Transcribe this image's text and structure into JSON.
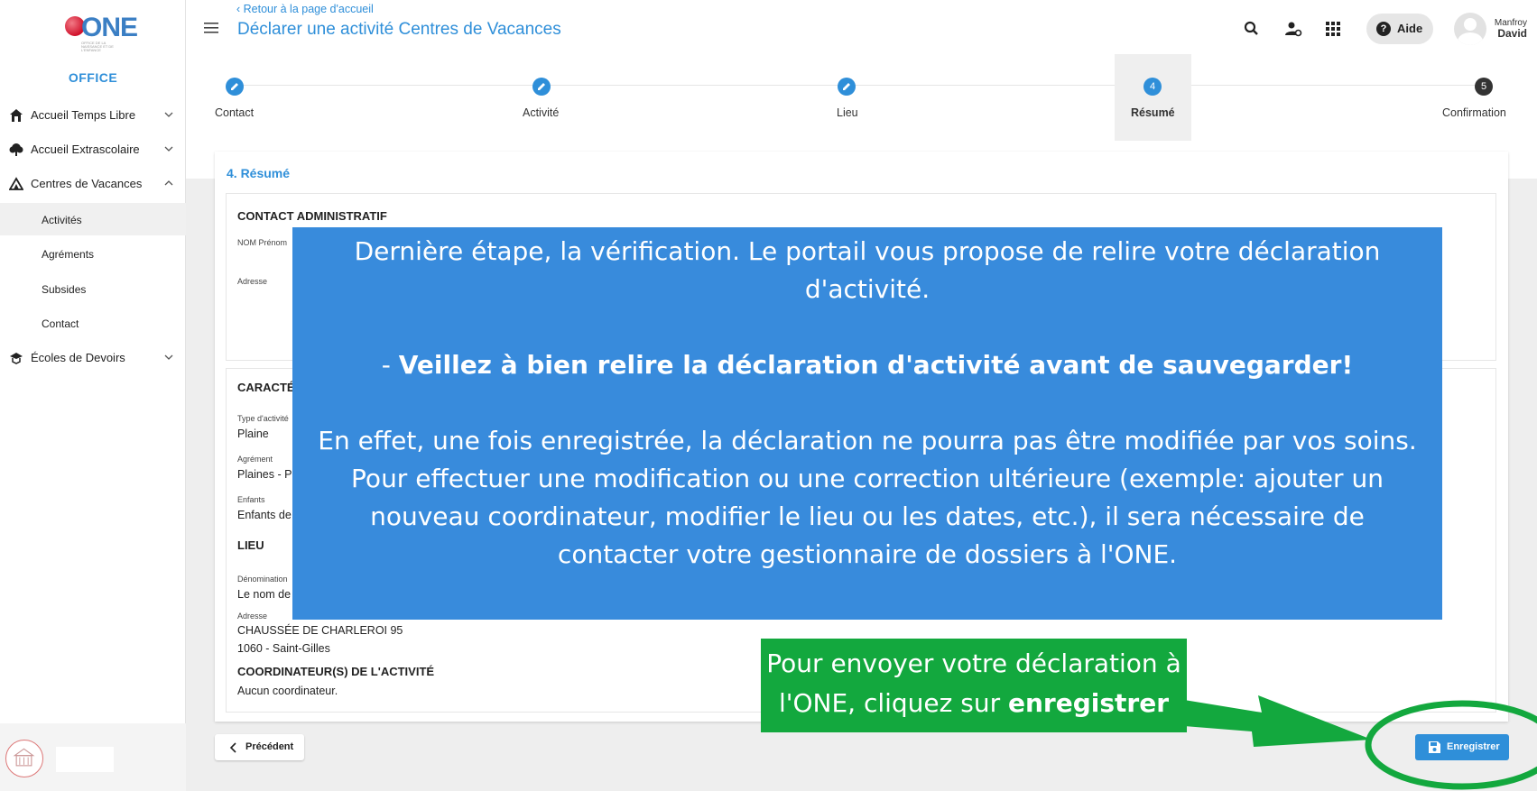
{
  "sidebar": {
    "logo_text": "ONE",
    "logo_tagline": "OFFICE DE LA NAISSANCE ET DE L'ENFANCE",
    "office_label": "OFFICE",
    "items": [
      {
        "label": "Accueil Temps Libre",
        "icon": "house-icon"
      },
      {
        "label": "Accueil Extrascolaire",
        "icon": "tree-icon"
      },
      {
        "label": "Centres de Vacances",
        "icon": "tent-icon"
      },
      {
        "label": "Écoles de Devoirs",
        "icon": "school-icon"
      }
    ],
    "subitems": [
      {
        "label": "Activités"
      },
      {
        "label": "Agréments"
      },
      {
        "label": "Subsides"
      },
      {
        "label": "Contact"
      }
    ]
  },
  "header": {
    "back_link": "Retour à la page d'accueil",
    "title": "Déclarer une activité Centres de Vacances",
    "aide_label": "Aide",
    "user_first": "Manfroy",
    "user_last": "David"
  },
  "stepper": {
    "steps": [
      {
        "label": "Contact",
        "state": "done"
      },
      {
        "label": "Activité",
        "state": "done"
      },
      {
        "label": "Lieu",
        "state": "done"
      },
      {
        "label": "Résumé",
        "number": "4",
        "state": "active"
      },
      {
        "label": "Confirmation",
        "number": "5",
        "state": "todo"
      }
    ]
  },
  "summary": {
    "title": "4. Résumé",
    "contact_header": "CONTACT ADMINISTRATIF",
    "nom_label": "NOM Prénom",
    "adresse_label": "Adresse",
    "carac_header": "CARACTÉ",
    "type_label": "Type d'activité",
    "type_value": "Plaine",
    "agrement_label": "Agrément",
    "agrement_value": "Plaines - P",
    "enfants_label": "Enfants",
    "enfants_value": "Enfants de",
    "lieu_header": "LIEU",
    "denomination_label": "Dénomination",
    "denomination_value": "Le nom de",
    "lieu_adresse_label": "Adresse",
    "lieu_adresse_line1": "CHAUSSÉE DE CHARLEROI 95",
    "lieu_adresse_line2": "1060 - Saint-Gilles",
    "coord_header": "COORDINATEUR(S) DE L'ACTIVITÉ",
    "coord_value": "Aucun coordinateur."
  },
  "buttons": {
    "prev_label": "Précédent",
    "save_label": "Enregistrer"
  },
  "tutorial": {
    "p1": "Dernière étape, la vérification. Le portail vous propose de relire votre déclaration d'activité.",
    "p2_prefix": "- ",
    "p2_bold": "Veillez à bien relire la déclaration d'activité avant de sauvegarder!",
    "p3": "En effet, une fois enregistrée, la déclaration ne pourra pas être modifiée par vos soins. Pour effectuer une modification ou une correction ultérieure (exemple: ajouter un nouveau coordinateur, modifier le lieu ou les dates, etc.), il sera nécessaire de contacter votre gestionnaire de dossiers à l'ONE."
  },
  "hint": {
    "text_line1": "Pour envoyer votre déclaration à",
    "text_line2_prefix": "l'ONE, cliquez sur ",
    "text_line2_bold": "enregistrer"
  },
  "colors": {
    "accent": "#2f8fd9",
    "tutorial_bg": "#388bdc",
    "hint_bg": "#13a83e",
    "step_done": "#2f8fd9",
    "step_todo": "#333333"
  }
}
